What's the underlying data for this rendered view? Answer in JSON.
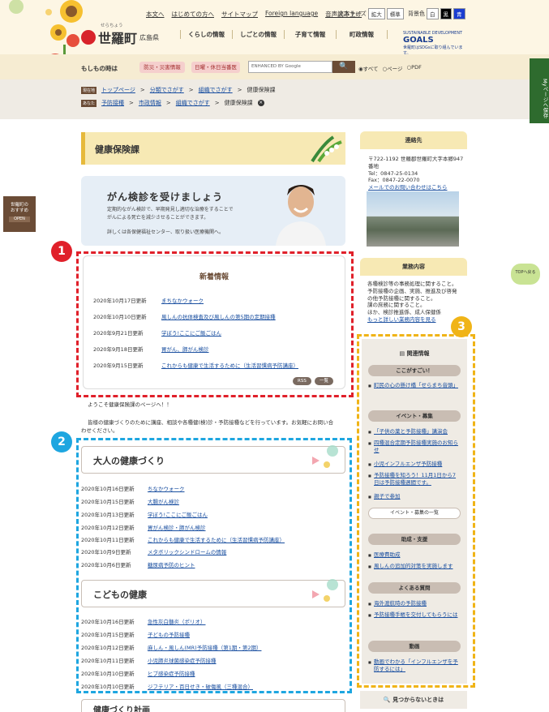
{
  "header": {
    "top_links": [
      "本文へ",
      "はじめての方へ",
      "サイトマップ",
      "Foreign language",
      "音声読み上げ"
    ],
    "font_size_label": "文字サイズ",
    "font_buttons": [
      "拡大",
      "標準"
    ],
    "bg_label": "背景色",
    "bg_buttons": [
      "白",
      "黒",
      "青"
    ],
    "logo_ruby": "せらちょう",
    "logo_name": "世羅町",
    "logo_pref": "広島県",
    "gnav": [
      "くらしの情報",
      "しごとの情報",
      "子育て情報",
      "町政情報"
    ],
    "sdgs_line1": "SUSTAINABLE DEVELOPMENT",
    "sdgs_big": "GOALS",
    "sdgs_line2": "世羅町はSDGsに取り組んでいます。"
  },
  "band": {
    "label": "もしもの時は",
    "pill1": "防災・災害情報",
    "pill2": "日曜・休日当番医",
    "search_placeholder": "ENHANCED BY Google",
    "search_button": "🔍",
    "radio1": "◉すべて",
    "radio2": "○ページ",
    "radio3": "○PDF"
  },
  "crumbs": {
    "tag1": "現在地",
    "row1": [
      "トップページ",
      "分類でさがす",
      "組織でさがす",
      "健康保険課"
    ],
    "tag2": "あなた",
    "row2": [
      "予防接種",
      "市政情報",
      "組織でさがす",
      "健康保険課"
    ],
    "sep": ">"
  },
  "side": {
    "mypage": "Myページへ保存",
    "osusume_l1": "世羅町の",
    "osusume_l2": "おすすめ",
    "osusume_open": "OPEN",
    "totop": "TOPへ戻る"
  },
  "main": {
    "page_title": "健康保険課",
    "banner_title": "がん検診を受けましょう",
    "banner_sub1": "定期的ながん検診で、早期発見し適切な治療をすることで",
    "banner_sub2": "がんによる死亡を減少させることができます。",
    "banner_sub3": "詳しくは各保健福祉センター、取り扱い医療機関へ。",
    "news_title": "新着情報",
    "news": [
      {
        "date": "2020年10月17日更新",
        "title": "まちなかウォーク"
      },
      {
        "date": "2020年10月10日更新",
        "title": "風しんの抗体検査及び風しんの第5期の定期接種"
      },
      {
        "date": "2020年9月21日更新",
        "title": "学ぼう!ここにご飯ごはん"
      },
      {
        "date": "2020年9月18日更新",
        "title": "胃がん、肺がん検診"
      },
      {
        "date": "2020年9月15日更新",
        "title": "これからも健康で生活するために（生活習慣病予防講座）"
      }
    ],
    "rss": "RSS",
    "list_btn": "一覧",
    "intro1": "ようこそ健康保険課のページへ！！",
    "intro2": "皆様の健康づくりのために講座、相談や各種健(検)診・予防接種などを行っています。お気軽にお問い合",
    "intro3": "わせください。",
    "sec1_title": "大人の健康づくり",
    "sec1": [
      {
        "date": "2020年10月16日更新",
        "title": "ちなかウォーク"
      },
      {
        "date": "2020年10月15日更新",
        "title": "大腸がん検診"
      },
      {
        "date": "2020年10月13日更新",
        "title": "学ぼう!ここにご飯ごはん"
      },
      {
        "date": "2020年10月12日更新",
        "title": "胃がん検診・肺がん検診"
      },
      {
        "date": "2020年10月11日更新",
        "title": "これからも健康で生活するために（生活習慣病予防講座）"
      },
      {
        "date": "2020年10月9日更新",
        "title": "メタボリックシンドロームの情報"
      },
      {
        "date": "2020年10月6日更新",
        "title": "糖尿病予防のヒント"
      }
    ],
    "sec2_title": "こどもの健康",
    "sec2": [
      {
        "date": "2020年10月16日更新",
        "title": "急性灰白髄炎（ポリオ）"
      },
      {
        "date": "2020年10月15日更新",
        "title": "子どもの予防接種"
      },
      {
        "date": "2020年10月12日更新",
        "title": "麻しん・風しん(MR)予防接種（第1期・第2期）"
      },
      {
        "date": "2020年10月11日更新",
        "title": "小児肺炎球菌感染症予防接種"
      },
      {
        "date": "2020年10月10日更新",
        "title": "ヒブ感染症予防接種"
      },
      {
        "date": "2020年10月10日更新",
        "title": "ジフテリア・百日せき・破傷風（三種混合）"
      }
    ],
    "sec3_title": "健康づくり計画"
  },
  "right": {
    "contact_title": "連絡先",
    "address": "〒722-1192 世羅郡世羅町大字本郷947番地",
    "tel": "Tel：0847-25-0134",
    "fax": "Fax：0847-22-0070",
    "mail": "メールでのお問い合わせはこちら",
    "gyomu_title": "業務内容",
    "gyomu1": "各種検診等の事務処理に関すること。",
    "gyomu2": "予防接種の企画、実施、推進及び啓発",
    "gyomu3": "の他予防接種に関すること。",
    "gyomu4": "課の庶務に関すること。",
    "gyomu5": "ほか、検診推進係、成人保健係",
    "gyomu_more": "もっと詳しい業務内容を見る",
    "kanren_title": "関連情報",
    "cat1": "ここがすごい！",
    "cat1_items": [
      "町民の心の懸け橋「せらまち音頭」"
    ],
    "cat2": "イベント・募集",
    "cat2_items": [
      "「子供の薬と予防接種」講演会",
      "四種混合定期予防接種実施のお知らせ",
      "小児インフルエンザ予防接種",
      "予防接種を知ろう！11月1日から7日は予防接種週間です。",
      "親子で参加"
    ],
    "cat2_btn": "イベント・募集の一覧",
    "cat3": "助成・支援",
    "cat3_items": [
      "医療費助成",
      "風しんの追加的対策を実施します"
    ],
    "cat4": "よくある質問",
    "cat4_items": [
      "海外渡航時の予防接種",
      "予防接種手帳を交付してもらうには"
    ],
    "cat5": "動画",
    "cat5_items": [
      "動画でわかる「インフルエンザを予防するには」"
    ],
    "notfound": "見つからないときは"
  },
  "markers": [
    "1",
    "2",
    "3"
  ],
  "colors": {
    "red": "#e0202a",
    "blue": "#1ea6e0",
    "gold": "#f0b417"
  }
}
